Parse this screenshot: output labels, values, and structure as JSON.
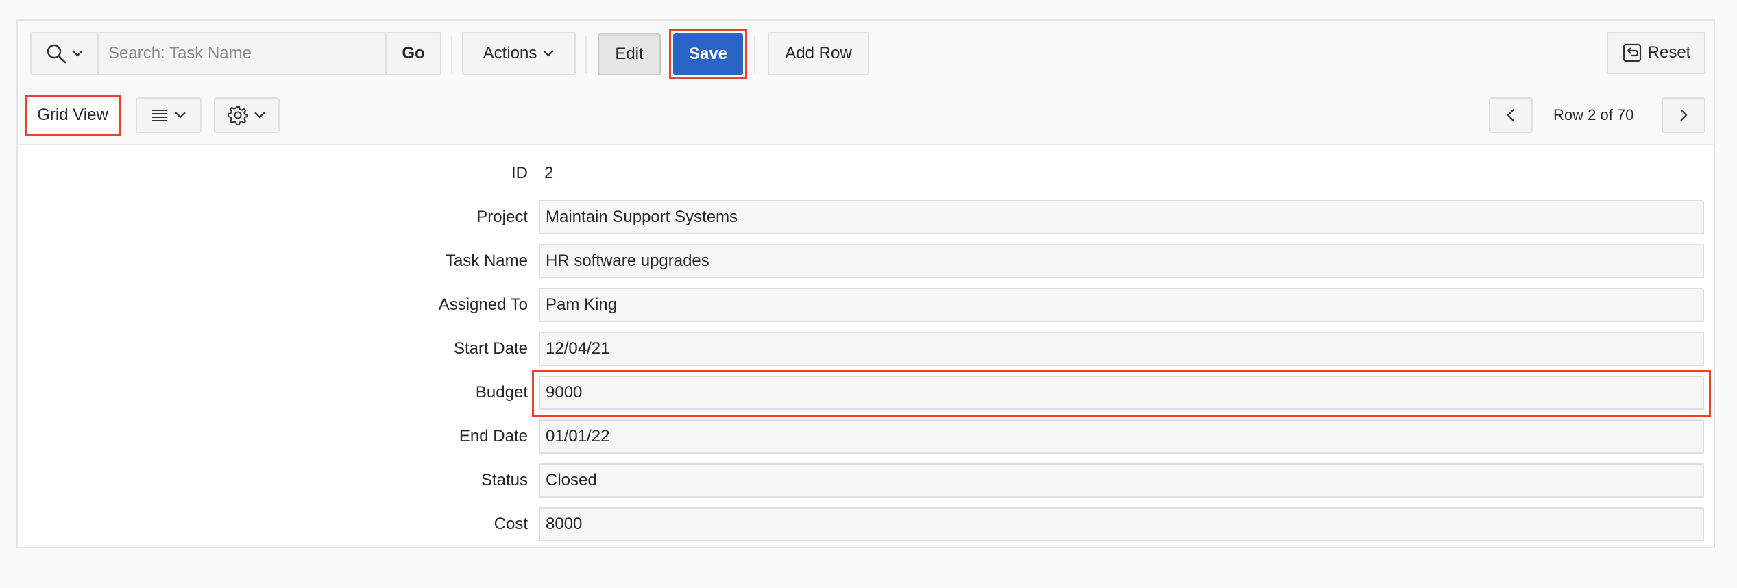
{
  "toolbar": {
    "search_placeholder": "Search: Task Name",
    "go_label": "Go",
    "actions_label": "Actions",
    "edit_label": "Edit",
    "save_label": "Save",
    "add_row_label": "Add Row",
    "reset_label": "Reset"
  },
  "subbar": {
    "grid_view_label": "Grid View",
    "pager_text": "Row 2 of 70"
  },
  "form": {
    "fields": [
      {
        "label": "ID",
        "value": "2"
      },
      {
        "label": "Project",
        "value": "Maintain Support Systems"
      },
      {
        "label": "Task Name",
        "value": "HR software upgrades"
      },
      {
        "label": "Assigned To",
        "value": "Pam King"
      },
      {
        "label": "Start Date",
        "value": "12/04/21"
      },
      {
        "label": "Budget",
        "value": "9000"
      },
      {
        "label": "End Date",
        "value": "01/01/22"
      },
      {
        "label": "Status",
        "value": "Closed"
      },
      {
        "label": "Cost",
        "value": "8000"
      }
    ]
  },
  "colors": {
    "save_button": "#2b64c7",
    "highlight_outline": "#e8412c"
  },
  "icons": [
    "search-icon",
    "chevron-down-icon",
    "list-icon",
    "gear-icon",
    "chevron-left-icon",
    "chevron-right-icon",
    "reset-icon"
  ]
}
